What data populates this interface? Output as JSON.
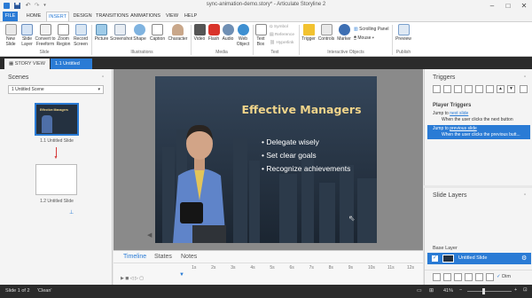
{
  "window": {
    "title": "sync-animation-demo.story* - Articulate Storyline 2"
  },
  "menu": {
    "tabs": [
      "FILE",
      "HOME",
      "INSERT",
      "DESIGN",
      "TRANSITIONS",
      "ANIMATIONS",
      "VIEW",
      "HELP"
    ],
    "active": "INSERT"
  },
  "ribbon": {
    "slide_group": {
      "label": "Slide",
      "buttons": [
        "New Slide",
        "Slide Layer",
        "Convert to Freeform",
        "Zoom Region",
        "Record Screen"
      ]
    },
    "illustrations_group": {
      "label": "Illustrations",
      "buttons": [
        "Picture",
        "Screenshot",
        "Shape",
        "Caption",
        "Character"
      ]
    },
    "media_group": {
      "label": "Media",
      "buttons": [
        "Video",
        "Flash",
        "Audio",
        "Web Object"
      ]
    },
    "text_group": {
      "label": "Text",
      "buttons": [
        "Text Box",
        "Symbol",
        "Reference",
        "Hyperlink"
      ]
    },
    "interactive_group": {
      "label": "Interactive Objects",
      "buttons": [
        "Trigger",
        "Controls",
        "Marker",
        "Scrolling Panel",
        "Mouse"
      ]
    },
    "publish_group": {
      "label": "Publish",
      "buttons": [
        "Preview"
      ]
    }
  },
  "doc_tabs": {
    "story_view": "STORY VIEW",
    "active_tab": "1.1 Untitled Sli..."
  },
  "scenes": {
    "title": "Scenes",
    "selected_scene": "1 Untitled Scene",
    "slides": [
      {
        "label": "1.1 Untitled Slide",
        "thumb_title": "Effective Managers"
      },
      {
        "label": "1.2 Untitled Slide"
      }
    ]
  },
  "slide": {
    "title": "Effective Managers",
    "bullets": [
      "Delegate wisely",
      "Set clear goals",
      "Recognize achievements"
    ]
  },
  "timeline": {
    "tabs": [
      "Timeline",
      "States",
      "Notes"
    ],
    "active": "Timeline",
    "ruler": [
      "1s",
      "2s",
      "3s",
      "4s",
      "5s",
      "6s",
      "7s",
      "8s",
      "9s",
      "10s",
      "11s",
      "12s"
    ]
  },
  "triggers": {
    "title": "Triggers",
    "section": "Player Triggers",
    "items": [
      {
        "line1_prefix": "Jump to ",
        "link": "next slide",
        "line2": "When the user clicks the next button",
        "selected": false
      },
      {
        "line1_prefix": "Jump to ",
        "link": "previous slide",
        "line2": "When the user clicks the previous butt...",
        "selected": true
      }
    ]
  },
  "slide_layers": {
    "title": "Slide Layers",
    "base_layer_label": "Base Layer",
    "layer_name": "Untitled Slide",
    "dim_label": "Dim"
  },
  "status": {
    "slide_info": "Slide 1 of 2",
    "theme": "'Clean'",
    "zoom": "41%"
  },
  "colors": {
    "accent": "#2a7bd5",
    "dark_strip": "#2b2b2b",
    "slide_bg": "#243140",
    "title_gold": "#f0d48a"
  }
}
